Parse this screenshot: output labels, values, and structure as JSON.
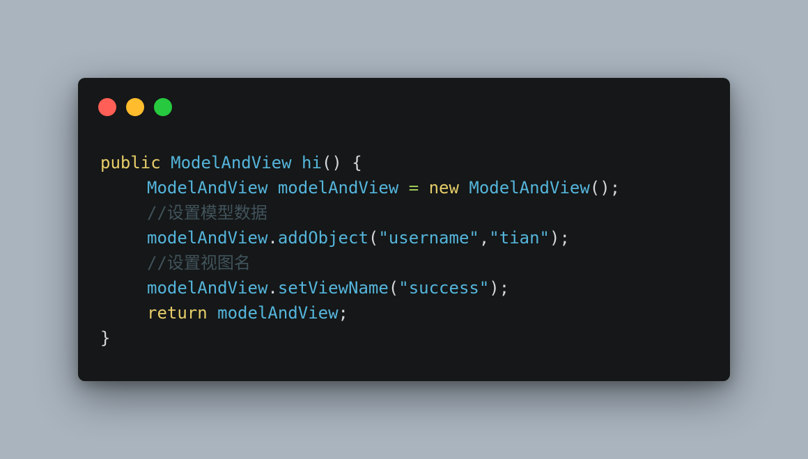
{
  "window": {
    "controls": [
      {
        "name": "close",
        "color": "#ff5f56"
      },
      {
        "name": "minimize",
        "color": "#ffbd2e"
      },
      {
        "name": "zoom",
        "color": "#27c93f"
      }
    ]
  },
  "code": {
    "language": "java",
    "colors": {
      "background": "#151718",
      "keyword": "#e6cd69",
      "identifier": "#55b5db",
      "operator": "#9fca56",
      "comment": "#41535b",
      "plain": "#d5d8da"
    },
    "lines": [
      {
        "indent": 0,
        "tokens": [
          {
            "t": "keyword",
            "v": "public"
          },
          {
            "t": "punct",
            "v": " "
          },
          {
            "t": "type",
            "v": "ModelAndView"
          },
          {
            "t": "punct",
            "v": " "
          },
          {
            "t": "func",
            "v": "hi"
          },
          {
            "t": "punct",
            "v": "() {"
          }
        ]
      },
      {
        "indent": 1,
        "tokens": [
          {
            "t": "type",
            "v": "ModelAndView"
          },
          {
            "t": "punct",
            "v": " "
          },
          {
            "t": "var",
            "v": "modelAndView"
          },
          {
            "t": "punct",
            "v": " "
          },
          {
            "t": "op",
            "v": "="
          },
          {
            "t": "punct",
            "v": " "
          },
          {
            "t": "keyword",
            "v": "new"
          },
          {
            "t": "punct",
            "v": " "
          },
          {
            "t": "type",
            "v": "ModelAndView"
          },
          {
            "t": "punct",
            "v": "();"
          }
        ]
      },
      {
        "indent": 1,
        "tokens": [
          {
            "t": "comment",
            "v": "//设置模型数据"
          }
        ]
      },
      {
        "indent": 1,
        "tokens": [
          {
            "t": "var",
            "v": "modelAndView"
          },
          {
            "t": "punct",
            "v": "."
          },
          {
            "t": "func",
            "v": "addObject"
          },
          {
            "t": "punct",
            "v": "("
          },
          {
            "t": "string",
            "v": "\"username\""
          },
          {
            "t": "punct",
            "v": ","
          },
          {
            "t": "string",
            "v": "\"tian\""
          },
          {
            "t": "punct",
            "v": ");"
          }
        ]
      },
      {
        "indent": 1,
        "tokens": [
          {
            "t": "comment",
            "v": "//设置视图名"
          }
        ]
      },
      {
        "indent": 1,
        "tokens": [
          {
            "t": "var",
            "v": "modelAndView"
          },
          {
            "t": "punct",
            "v": "."
          },
          {
            "t": "func",
            "v": "setViewName"
          },
          {
            "t": "punct",
            "v": "("
          },
          {
            "t": "string",
            "v": "\"success\""
          },
          {
            "t": "punct",
            "v": ");"
          }
        ]
      },
      {
        "indent": 1,
        "tokens": [
          {
            "t": "keyword",
            "v": "return"
          },
          {
            "t": "punct",
            "v": " "
          },
          {
            "t": "var",
            "v": "modelAndView"
          },
          {
            "t": "punct",
            "v": ";"
          }
        ]
      },
      {
        "indent": 0,
        "tokens": [
          {
            "t": "punct",
            "v": "}"
          }
        ]
      }
    ]
  }
}
